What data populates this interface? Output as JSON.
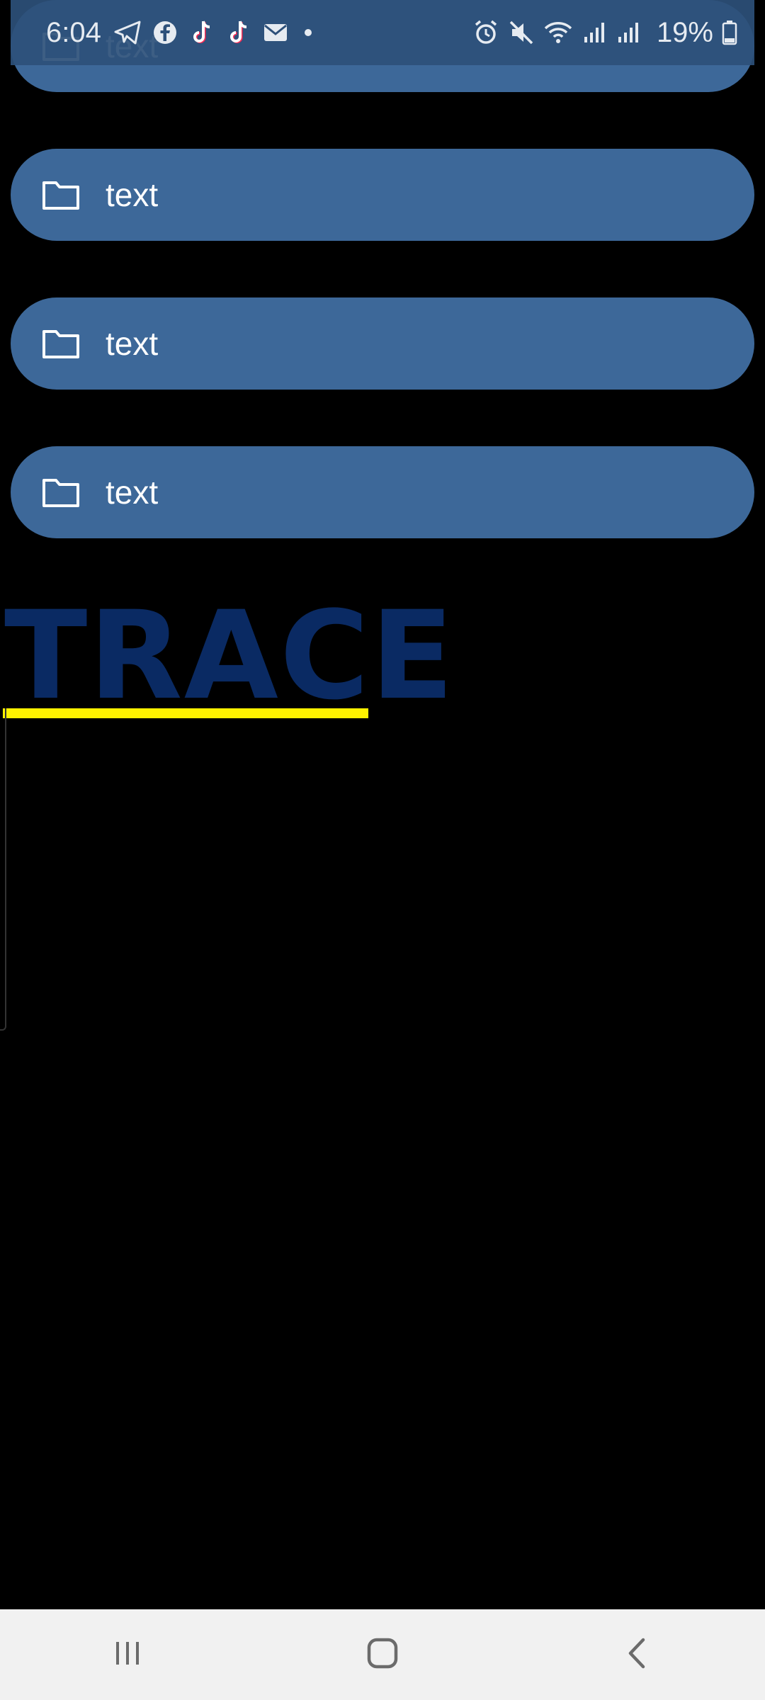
{
  "status_bar": {
    "time": "6:04",
    "battery": "19%",
    "notification_icons": [
      "telegram-icon",
      "facebook-icon",
      "tiktok-icon",
      "tiktok-icon",
      "gmail-icon",
      "more-dot-icon"
    ],
    "system_icons": [
      "alarm-icon",
      "mute-icon",
      "wifi-icon",
      "signal-icon",
      "signal-icon",
      "battery-icon"
    ]
  },
  "folders": [
    {
      "label": "text",
      "icon": "folder-icon"
    },
    {
      "label": "text",
      "icon": "folder-icon"
    },
    {
      "label": "text",
      "icon": "folder-icon"
    },
    {
      "label": "text",
      "icon": "folder-icon"
    }
  ],
  "trace": {
    "title": "TRACE"
  },
  "nav": {
    "recents": "recents-icon",
    "home": "home-icon",
    "back": "back-icon"
  },
  "colors": {
    "folder_pill": "#3d6899",
    "status_bar": "#2d507a",
    "trace_text": "#0a2a63",
    "trace_underline": "#fff200",
    "nav_bar": "#f1f1f1"
  }
}
